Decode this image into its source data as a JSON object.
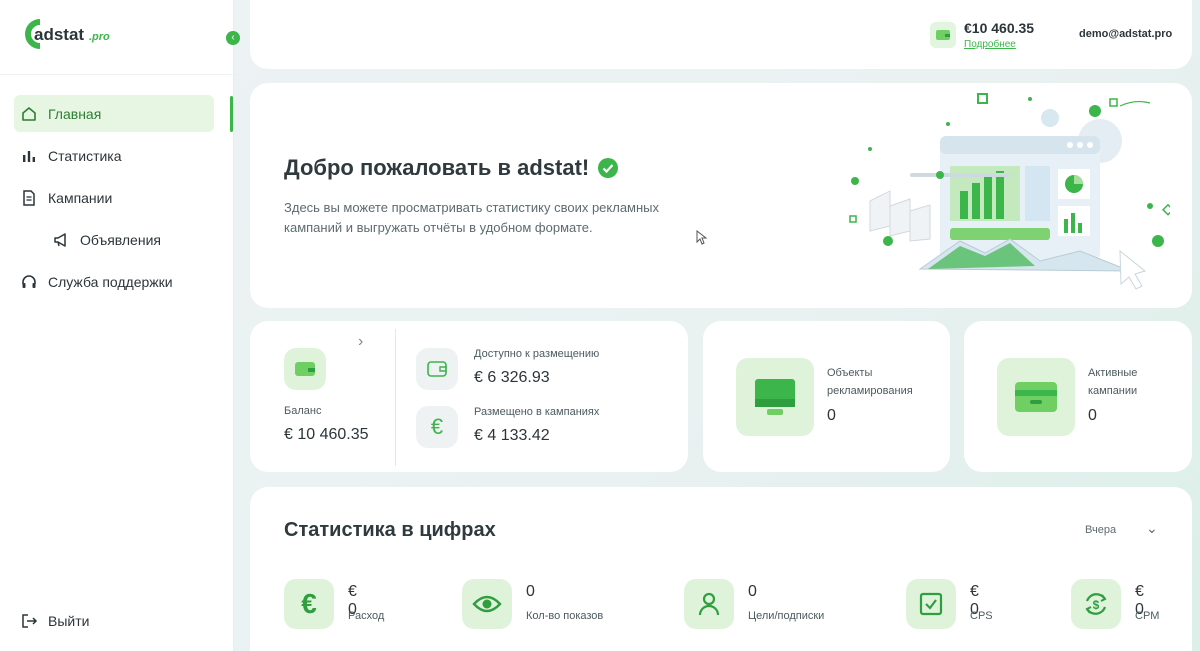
{
  "brand": {
    "logo_text": "adstat",
    "logo_suffix": ".pro",
    "accent": "#3cb54a"
  },
  "sidebar": {
    "items": [
      {
        "label": "Главная",
        "icon": "home-icon"
      },
      {
        "label": "Статистика",
        "icon": "bar-chart-icon"
      },
      {
        "label": "Кампании",
        "icon": "document-icon"
      },
      {
        "label": "Объявления",
        "icon": "megaphone-icon"
      },
      {
        "label": "Служба поддержки",
        "icon": "headset-icon"
      }
    ],
    "logout": "Выйти"
  },
  "topbar": {
    "balance": "€10 460.35",
    "more_link": "Подробнее",
    "user": "demo@adstat.pro"
  },
  "welcome": {
    "title": "Добро пожаловать в adstat!",
    "text": "Здесь вы можете просматривать статистику своих рекламных кампаний и выгружать отчёты в удобном формате."
  },
  "balance_card": {
    "balance_label": "Баланс",
    "balance_value": "€ 10 460.35",
    "available_label": "Доступно к размещению",
    "available_value": "€ 6 326.93",
    "placed_label": "Размещено в кампаниях",
    "placed_value": "€ 4 133.42"
  },
  "objects_card": {
    "label_line1": "Объекты",
    "label_line2": "рекламирования",
    "value": "0"
  },
  "campaigns_card": {
    "label_line1": "Активные",
    "label_line2": "кампании",
    "value": "0"
  },
  "stats": {
    "title": "Статистика в цифрах",
    "period": "Вчера",
    "items": [
      {
        "value": "€ 0",
        "label": "Расход",
        "icon": "euro-icon"
      },
      {
        "value": "0",
        "label": "Кол-во показов",
        "icon": "eye-icon"
      },
      {
        "value": "0",
        "label": "Цели/подписки",
        "icon": "user-icon"
      },
      {
        "value": "€ 0",
        "label": "CPS",
        "icon": "checkbox-icon"
      },
      {
        "value": "€ 0",
        "label": "CPM",
        "icon": "currency-refresh-icon"
      }
    ]
  }
}
